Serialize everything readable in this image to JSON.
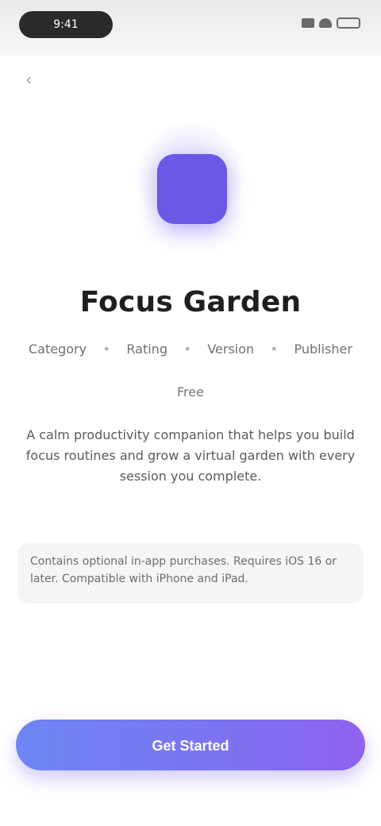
{
  "status_bar": {
    "time": "9:41"
  },
  "header": {
    "back_icon": "chevron-left-icon"
  },
  "app": {
    "icon_color": "#6a58e6",
    "name": "Focus Garden"
  },
  "meta": {
    "items": [
      "Category",
      "Rating",
      "Version",
      "Publisher"
    ],
    "secondary": "Free"
  },
  "description": "A calm productivity companion that helps you build focus routines and grow a virtual garden with every session you complete.",
  "info_card": "Contains optional in-app purchases. Requires iOS 16 or later. Compatible with iPhone and iPad.",
  "cta": {
    "label": "Get Started",
    "gradient_start": "#6e86f3",
    "gradient_end": "#8f63ee"
  }
}
